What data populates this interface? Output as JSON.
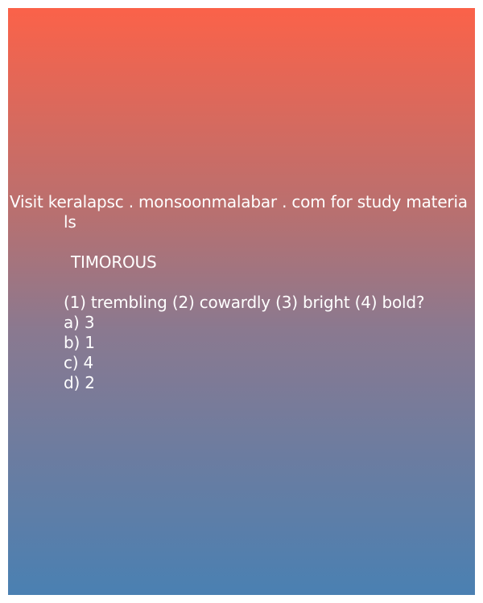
{
  "header": {
    "line1": "Visit keralapsc . monsoonmalabar . com for study materia",
    "line2": "ls"
  },
  "question": {
    "word": "TIMOROUS",
    "text": "(1) trembling (2) cowardly (3) bright (4) bold?",
    "options": [
      "a) 3",
      "b) 1",
      "c) 4",
      "d) 2"
    ]
  },
  "colors": {
    "gradient_top": "#fb6249",
    "gradient_bottom": "#4a80b2",
    "text": "#ffffff"
  }
}
